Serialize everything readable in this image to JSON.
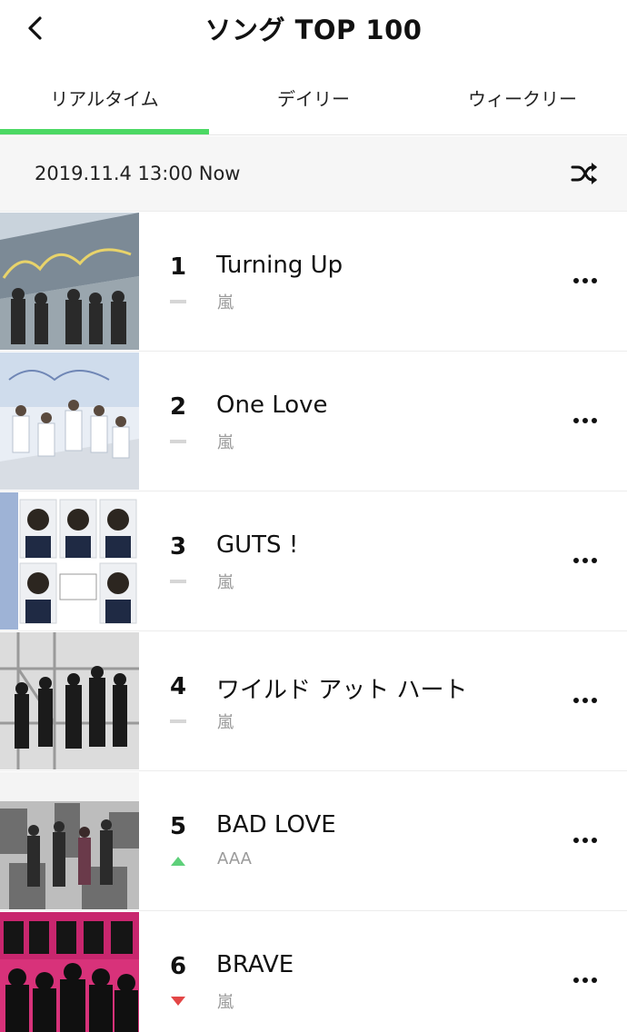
{
  "header": {
    "title": "ソング TOP 100"
  },
  "tabs": [
    {
      "label": "リアルタイム",
      "active": true
    },
    {
      "label": "デイリー",
      "active": false
    },
    {
      "label": "ウィークリー",
      "active": false
    }
  ],
  "info_bar": {
    "timestamp": "2019.11.4 13:00 Now"
  },
  "colors": {
    "accent": "#4cd964",
    "rank_up": "#5ed07a",
    "rank_down": "#e34646",
    "rank_same": "#d6d6d6"
  },
  "songs": [
    {
      "rank": "1",
      "title": "Turning Up",
      "artist": "嵐",
      "change": "same"
    },
    {
      "rank": "2",
      "title": "One Love",
      "artist": "嵐",
      "change": "same"
    },
    {
      "rank": "3",
      "title": "GUTS !",
      "artist": "嵐",
      "change": "same"
    },
    {
      "rank": "4",
      "title": "ワイルド アット ハート",
      "artist": "嵐",
      "change": "same"
    },
    {
      "rank": "5",
      "title": "BAD LOVE",
      "artist": "AAA",
      "change": "up"
    },
    {
      "rank": "6",
      "title": "BRAVE",
      "artist": "嵐",
      "change": "down"
    }
  ]
}
